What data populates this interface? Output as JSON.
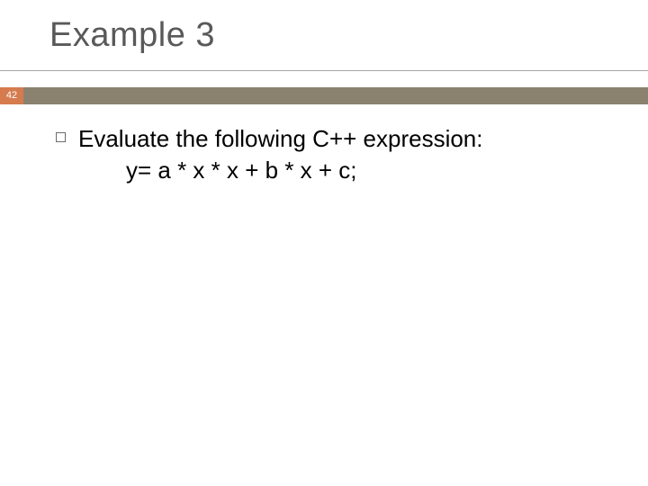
{
  "slide": {
    "title": "Example 3",
    "page_number": "42",
    "bullet": {
      "line1": "Evaluate the following C++ expression:",
      "line2": "y= a * x * x + b * x + c;"
    }
  }
}
